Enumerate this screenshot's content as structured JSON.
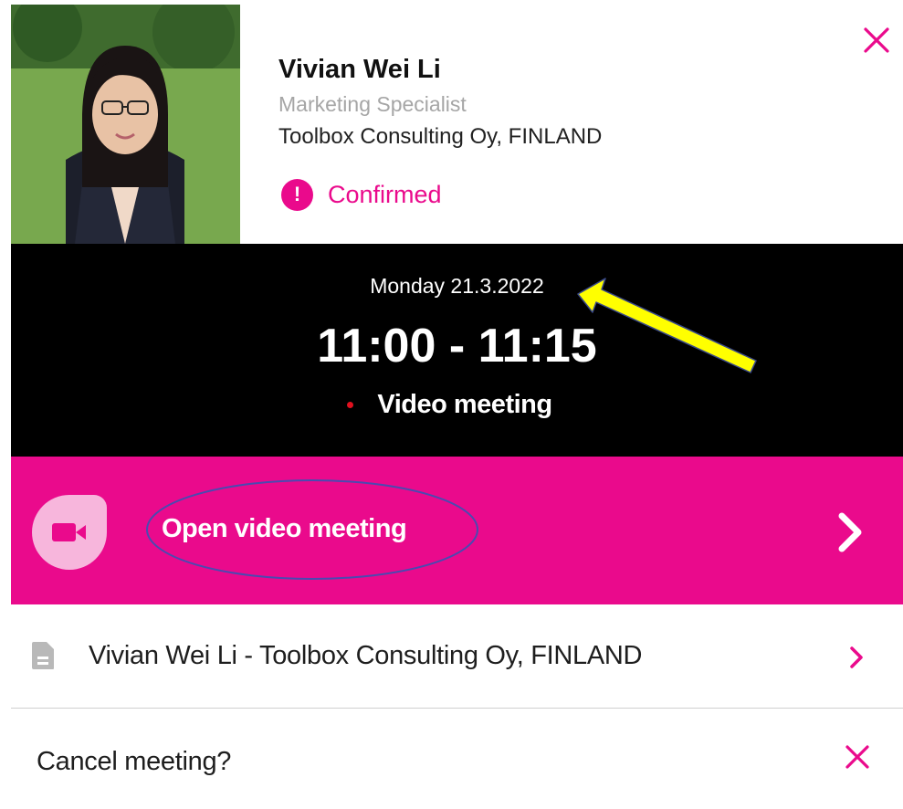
{
  "colors": {
    "accent": "#ea0a8c",
    "annotation_arrow": "#ffff00",
    "annotation_ellipse": "#4a4ab0"
  },
  "contact": {
    "name": "Vivian Wei Li",
    "title": "Marketing Specialist",
    "company": "Toolbox Consulting Oy, FINLAND",
    "photo_icon": "profile-photo"
  },
  "status": {
    "icon": "exclamation-icon",
    "icon_glyph": "!",
    "label": "Confirmed"
  },
  "meeting": {
    "date": "Monday 21.3.2022",
    "time": "11:00 - 11:15",
    "type": "Video meeting"
  },
  "actions": {
    "open_video": "Open video meeting",
    "profile_link": "Vivian Wei Li - Toolbox Consulting Oy, FINLAND",
    "cancel": "Cancel meeting?"
  },
  "icons": {
    "close": "close-icon",
    "video": "video-camera-icon",
    "document": "document-icon",
    "chevron": "chevron-right-icon"
  }
}
